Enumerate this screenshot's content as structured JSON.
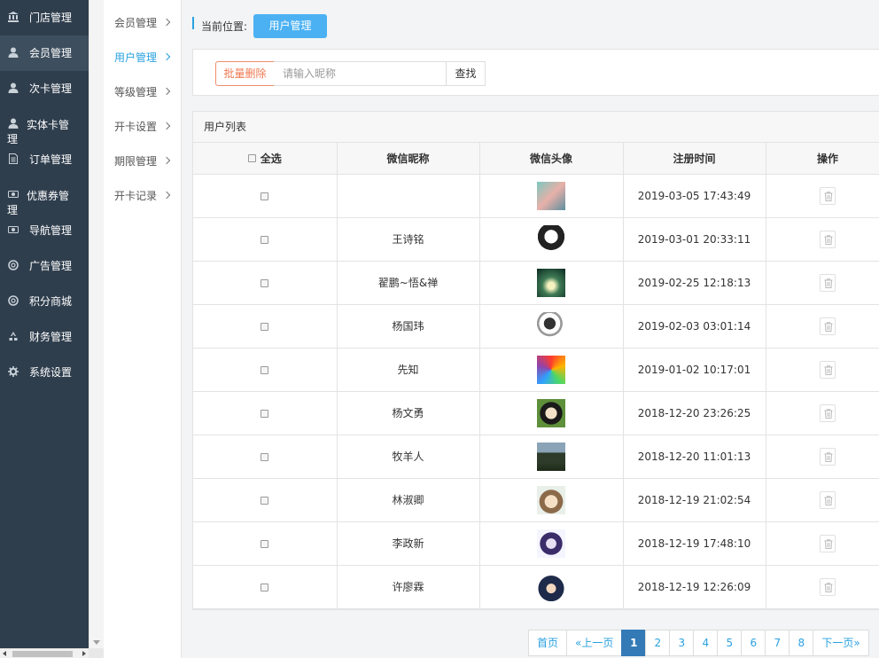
{
  "sidebar": {
    "items": [
      {
        "label": "门店管理",
        "icon": "bank-icon"
      },
      {
        "label": "会员管理",
        "icon": "user-icon",
        "active": true
      },
      {
        "label": "次卡管理",
        "icon": "user-icon"
      },
      {
        "label": "实体卡管理",
        "icon": "user-icon"
      },
      {
        "label": "订单管理",
        "icon": "document-icon"
      },
      {
        "label": "优惠券管理",
        "icon": "coupon-icon"
      },
      {
        "label": "导航管理",
        "icon": "coupon-icon"
      },
      {
        "label": "广告管理",
        "icon": "lifebuoy-icon"
      },
      {
        "label": "积分商城",
        "icon": "lifebuoy-icon"
      },
      {
        "label": "财务管理",
        "icon": "recycle-icon"
      },
      {
        "label": "系统设置",
        "icon": "gear-icon"
      }
    ]
  },
  "submenu": {
    "items": [
      {
        "label": "会员管理"
      },
      {
        "label": "用户管理",
        "active": true
      },
      {
        "label": "等级管理"
      },
      {
        "label": "开卡设置"
      },
      {
        "label": "期限管理"
      },
      {
        "label": "开卡记录"
      }
    ]
  },
  "breadcrumb": {
    "label": "当前位置:",
    "current": "用户管理"
  },
  "toolbar": {
    "batch_delete": "批量删除",
    "search_placeholder": "请输入昵称",
    "search_value": "",
    "find": "查找"
  },
  "table": {
    "title": "用户列表",
    "columns": [
      "全选",
      "微信昵称",
      "微信头像",
      "注册时间",
      "操作"
    ],
    "rows": [
      {
        "nickname": "",
        "registered": "2019-03-05 17:43:49"
      },
      {
        "nickname": "王诗铭",
        "registered": "2019-03-01 20:33:11"
      },
      {
        "nickname": "翟鹏~悟&禅",
        "registered": "2019-02-25 12:18:13"
      },
      {
        "nickname": "杨国玮",
        "registered": "2019-02-03 03:01:14"
      },
      {
        "nickname": "先知",
        "registered": "2019-01-02 10:17:01"
      },
      {
        "nickname": "杨文勇",
        "registered": "2018-12-20 23:26:25"
      },
      {
        "nickname": "牧羊人",
        "registered": "2018-12-20 11:01:13"
      },
      {
        "nickname": "林淑卿",
        "registered": "2018-12-19 21:02:54"
      },
      {
        "nickname": "李政新",
        "registered": "2018-12-19 17:48:10"
      },
      {
        "nickname": "许廖霖",
        "registered": "2018-12-19 12:26:09"
      }
    ]
  },
  "pagination": {
    "first": "首页",
    "prev": "«上一页",
    "pages": [
      "1",
      "2",
      "3",
      "4",
      "5",
      "6",
      "7",
      "8"
    ],
    "current": "1",
    "next": "下一页»"
  },
  "colors": {
    "sidebar_bg": "#2f3e4d",
    "accent": "#2aa1e0",
    "primary_button": "#4bb1f3",
    "danger": "#f07850",
    "pager_active": "#337ab7"
  }
}
